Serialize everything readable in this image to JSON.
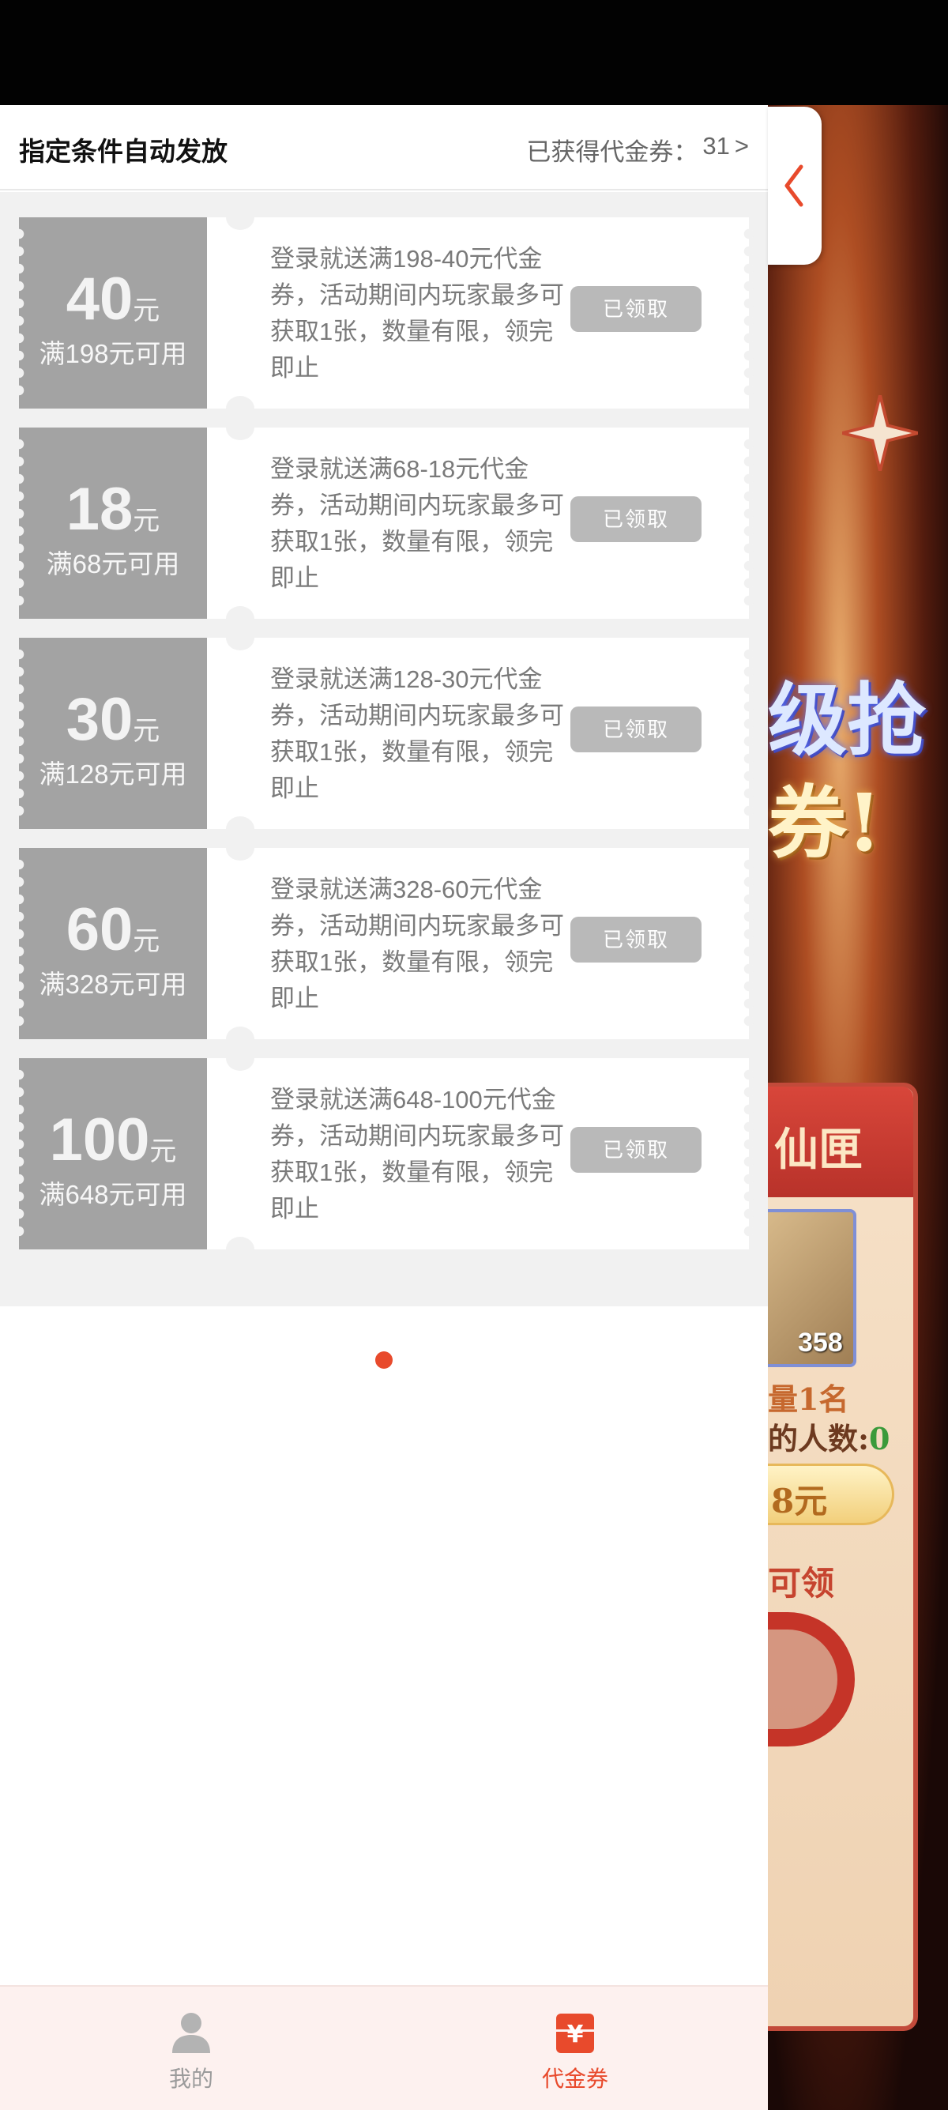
{
  "header": {
    "title": "指定条件自动发放",
    "obtained_label": "已获得代金券：",
    "obtained_count": "31",
    "obtained_arrow": ">"
  },
  "coupons": [
    {
      "amount": "40",
      "unit": "元",
      "condition": "满198元可用",
      "description": "登录就送满198-40元代金券，活动期间内玩家最多可获取1张，数量有限，领完即止",
      "button": "已领取"
    },
    {
      "amount": "18",
      "unit": "元",
      "condition": "满68元可用",
      "description": "登录就送满68-18元代金券，活动期间内玩家最多可获取1张，数量有限，领完即止",
      "button": "已领取"
    },
    {
      "amount": "30",
      "unit": "元",
      "condition": "满128元可用",
      "description": "登录就送满128-30元代金券，活动期间内玩家最多可获取1张，数量有限，领完即止",
      "button": "已领取"
    },
    {
      "amount": "60",
      "unit": "元",
      "condition": "满328元可用",
      "description": "登录就送满328-60元代金券，活动期间内玩家最多可获取1张，数量有限，领完即止",
      "button": "已领取"
    },
    {
      "amount": "100",
      "unit": "元",
      "condition": "满648元可用",
      "description": "登录就送满648-100元代金券，活动期间内玩家最多可获取1张，数量有限，领完即止",
      "button": "已领取"
    }
  ],
  "bottom_nav": {
    "me": {
      "label": "我的",
      "icon": "person-icon"
    },
    "coupon": {
      "label": "代金券",
      "icon": "yen-coupon-icon",
      "icon_glyph": "¥"
    }
  },
  "game": {
    "title_line1": "级抢",
    "title_line2": "券!",
    "card_header": "仙匣",
    "item_count": "358",
    "line_a": "量1名",
    "line_b_label": "的人数:",
    "line_b_value": "0",
    "price": "8元",
    "line_c": "可领"
  },
  "colors": {
    "accent": "#e84a2c",
    "coupon_disabled": "#a3a3a3",
    "button_disabled": "#b9b9b9"
  }
}
